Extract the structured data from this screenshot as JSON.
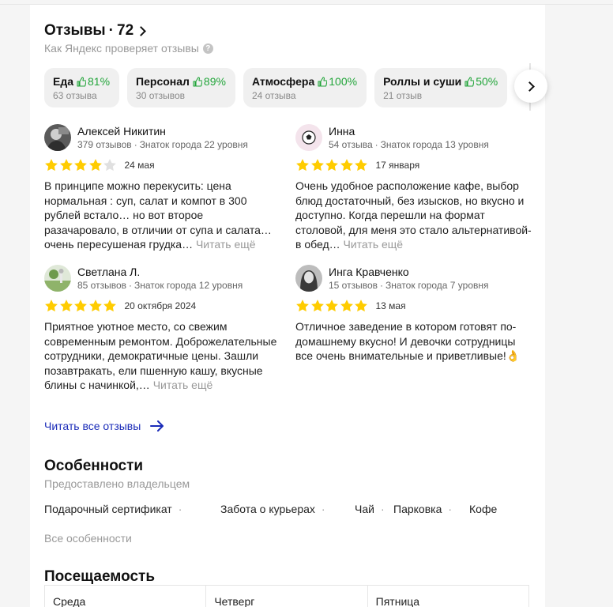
{
  "header": {
    "title": "Отзывы",
    "separator": "·",
    "count": "72",
    "subtitle": "Как Яндекс проверяет отзывы",
    "help_symbol": "?"
  },
  "aspects": [
    {
      "name": "Еда",
      "percent": "81%",
      "count": "63 отзыва"
    },
    {
      "name": "Персонал",
      "percent": "89%",
      "count": "30 отзывов"
    },
    {
      "name": "Атмосфера",
      "percent": "100%",
      "count": "24 отзыва"
    },
    {
      "name": "Роллы и суши",
      "percent": "50%",
      "count": "21 отзыв"
    }
  ],
  "reviews": [
    {
      "name": "Алексей Никитин",
      "reviews_count": "379 отзывов",
      "level": "Знаток города 22 уровня",
      "rating": 4,
      "date": "24 мая",
      "text": "В принципе можно перекусить: цена нормальная : суп, салат и компот в 300 рублей встало… но вот второе разачаровало, в отличии от супа и салата… очень пересушеная грудка…",
      "read_more": "Читать ещё",
      "avatar_icon": "user-photo-icon"
    },
    {
      "name": "Инна",
      "reviews_count": "54 отзыва",
      "level": "Знаток города 13 уровня",
      "rating": 5,
      "date": "17 января",
      "text": "Очень удобное расположение кафе, выбор блюд достаточный, без изысков, но вкусно и доступно. Когда перешли на формат столовой, для меня это стало альтернативой-в обед…",
      "read_more": "Читать ещё",
      "avatar_icon": "soccer-ball-icon"
    },
    {
      "name": "Светлана Л.",
      "reviews_count": "85 отзывов",
      "level": "Знаток города 12 уровня",
      "rating": 5,
      "date": "20 октября 2024",
      "text": "Приятное уютное место, со свежим современным ремонтом. Доброжелательные сотрудники, демократичные цены. Зашли позавтракать, ели пшенную кашу, вкусные блины с начинкой,…",
      "read_more": "Читать ещё",
      "avatar_icon": "nature-photo-icon"
    },
    {
      "name": "Инга Кравченко",
      "reviews_count": "15 отзывов",
      "level": "Знаток города 7 уровня",
      "rating": 5,
      "date": "13 мая",
      "text": "Отличное заведение в котором готовят по-домашнему вкусно! И девочки сотрудницы все очень внимательные и приветливые!👌",
      "read_more": "",
      "avatar_icon": "woman-photo-icon"
    }
  ],
  "meta_separator": "·",
  "all_reviews_label": "Читать все отзывы",
  "features": {
    "title": "Особенности",
    "subtitle": "Предоставлено владельцем",
    "items": [
      "Подарочный сертификат",
      "Забота о курьерах",
      "Чай",
      "Парковка",
      "Кофе"
    ],
    "separator": "·",
    "all_label": "Все особенности"
  },
  "attendance": {
    "title": "Посещаемость",
    "days": [
      "Среда",
      "Четверг",
      "Пятница"
    ]
  },
  "colors": {
    "positive": "#22a53a",
    "star": "#ffcc00",
    "star_empty": "#e0e0e0",
    "link": "#1a2bb8"
  }
}
